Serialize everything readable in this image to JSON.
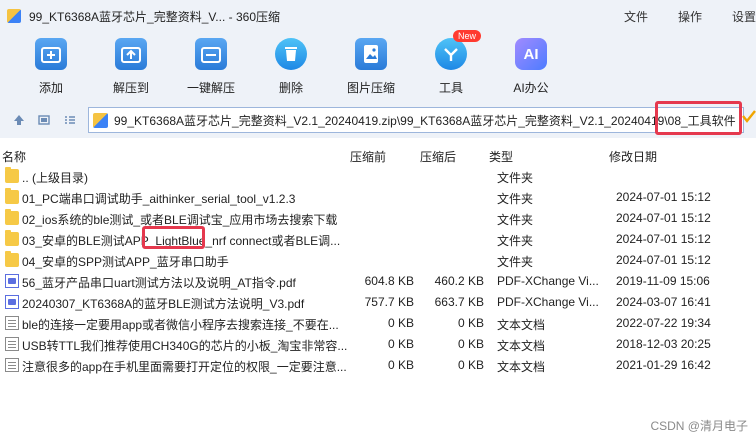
{
  "window": {
    "title": "99_KT6368A蓝牙芯片_完整资料_V... - 360压缩",
    "menu": [
      "文件",
      "操作",
      "设置"
    ]
  },
  "toolbar": {
    "buttons": [
      {
        "label": "添加",
        "icon": "add-icon"
      },
      {
        "label": "解压到",
        "icon": "extract-to-icon"
      },
      {
        "label": "一键解压",
        "icon": "one-click-extract-icon"
      },
      {
        "label": "删除",
        "icon": "delete-icon"
      },
      {
        "label": "图片压缩",
        "icon": "image-compress-icon"
      },
      {
        "label": "工具",
        "icon": "tools-icon",
        "badge": "New"
      },
      {
        "label": "AI办公",
        "icon": "ai-office-icon",
        "glyph": "AI"
      }
    ]
  },
  "address": {
    "path": "99_KT6368A蓝牙芯片_完整资料_V2.1_20240419.zip\\99_KT6368A蓝牙芯片_完整资料_V2.1_20240419\\08_工具软件"
  },
  "columns": {
    "name": "名称",
    "before": "压缩前",
    "after": "压缩后",
    "type": "类型",
    "date": "修改日期"
  },
  "rows": [
    {
      "icon": "folder",
      "name": ".. (上级目录)",
      "before": "",
      "after": "",
      "type": "文件夹",
      "date": ""
    },
    {
      "icon": "folder",
      "name": "01_PC端串口调试助手_aithinker_serial_tool_v1.2.3",
      "before": "",
      "after": "",
      "type": "文件夹",
      "date": "2024-07-01 15:12"
    },
    {
      "icon": "folder",
      "name": "02_ios系统的ble测试_或者BLE调试宝_应用市场去搜索下载",
      "before": "",
      "after": "",
      "type": "文件夹",
      "date": "2024-07-01 15:12"
    },
    {
      "icon": "folder",
      "name": "03_安卓的BLE测试APP_LightBlue_nrf connect或者BLE调...",
      "before": "",
      "after": "",
      "type": "文件夹",
      "date": "2024-07-01 15:12"
    },
    {
      "icon": "folder",
      "name": "04_安卓的SPP测试APP_蓝牙串口助手",
      "before": "",
      "after": "",
      "type": "文件夹",
      "date": "2024-07-01 15:12"
    },
    {
      "icon": "pdf",
      "name": "56_蓝牙产品串口uart测试方法以及说明_AT指令.pdf",
      "before": "604.8 KB",
      "after": "460.2 KB",
      "type": "PDF-XChange Vi...",
      "date": "2019-11-09 15:06"
    },
    {
      "icon": "pdf",
      "name": "20240307_KT6368A的蓝牙BLE测试方法说明_V3.pdf",
      "before": "757.7 KB",
      "after": "663.7 KB",
      "type": "PDF-XChange Vi...",
      "date": "2024-03-07 16:41"
    },
    {
      "icon": "txt",
      "name": "ble的连接一定要用app或者微信小程序去搜索连接_不要在...",
      "before": "0 KB",
      "after": "0 KB",
      "type": "文本文档",
      "date": "2022-07-22 19:34"
    },
    {
      "icon": "txt",
      "name": "USB转TTL我们推荐使用CH340G的芯片的小板_淘宝非常容...",
      "before": "0 KB",
      "after": "0 KB",
      "type": "文本文档",
      "date": "2018-12-03 20:25"
    },
    {
      "icon": "txt",
      "name": "注意很多的app在手机里面需要打开定位的权限_一定要注意...",
      "before": "0 KB",
      "after": "0 KB",
      "type": "文本文档",
      "date": "2021-01-29 16:42"
    }
  ],
  "watermark": "CSDN @清月电子",
  "colors": {
    "highlight": "#e5394e",
    "toolbar_bg": "#eef2f8",
    "folder": "#f6c946"
  }
}
